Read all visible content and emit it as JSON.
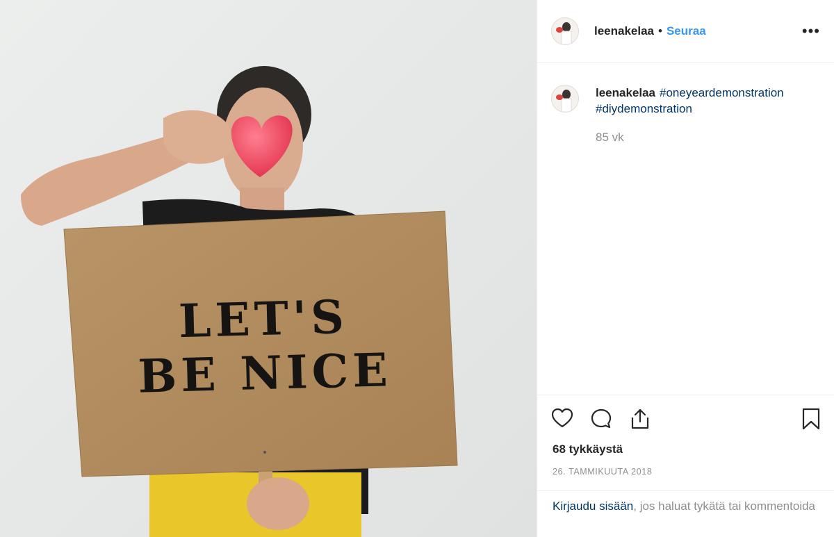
{
  "header": {
    "username": "leenakelaa",
    "separator": "•",
    "follow_label": "Seuraa",
    "more_label": "•••"
  },
  "photo": {
    "sign_line1": "LET'S",
    "sign_line2": "BE NICE"
  },
  "caption": {
    "username": "leenakelaa",
    "hashtag1": "#oneyeardemonstration",
    "hashtag2": "#diydemonstration",
    "age": "85 vk"
  },
  "actions": {
    "icons": [
      "heart-icon",
      "comment-icon",
      "share-icon",
      "bookmark-icon"
    ],
    "likes": "68 tykkäystä",
    "date": "26. TAMMIKUUTA 2018"
  },
  "login": {
    "link": "Kirjaudu sisään",
    "text": ", jos haluat tykätä tai kommentoida"
  },
  "colors": {
    "link_blue": "#3897f0",
    "hashtag_blue": "#003569",
    "muted": "#8e8e8e",
    "cardboard": "#b08a5c",
    "heart_red": "#ef3e57",
    "leggings_yellow": "#e9c62a"
  }
}
